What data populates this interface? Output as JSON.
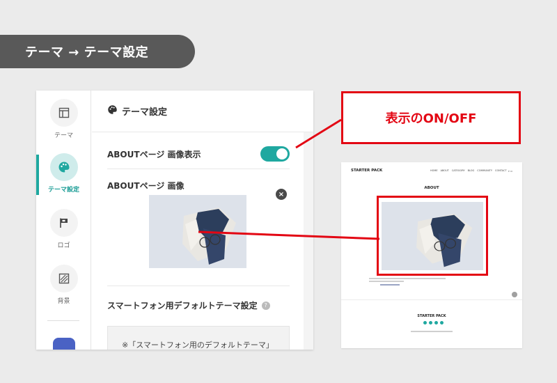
{
  "header": {
    "title": "テーマ → テーマ設定"
  },
  "rail": {
    "items": [
      {
        "label": "テーマ",
        "icon": "layout-icon"
      },
      {
        "label": "テーマ設定",
        "icon": "palette-icon",
        "active": true
      },
      {
        "label": "ロゴ",
        "icon": "flag-icon"
      },
      {
        "label": "背景",
        "icon": "pattern-icon"
      }
    ]
  },
  "panel": {
    "title": "テーマ設定",
    "about_toggle_label": "ABOUTページ 画像表示",
    "about_toggle_on": true,
    "about_image_label": "ABOUTページ 画像",
    "close_symbol": "×",
    "smartphone_label": "スマートフォン用デフォルトテーマ設定",
    "help_symbol": "?",
    "notice_text": "※「スマートフォン用のデフォルトテーマ」"
  },
  "callout": {
    "text": "表示のON/OFF"
  },
  "preview": {
    "brand": "STARTER PACK",
    "nav": [
      "HOME",
      "ABOUT",
      "CATEGORY",
      "BLOG",
      "COMMUNITY",
      "CONTACT"
    ],
    "page_title": "ABOUT",
    "footer_brand": "STARTER PACK"
  },
  "colors": {
    "accent": "#1fa8a0",
    "highlight": "#e30613",
    "pill": "#595959"
  }
}
